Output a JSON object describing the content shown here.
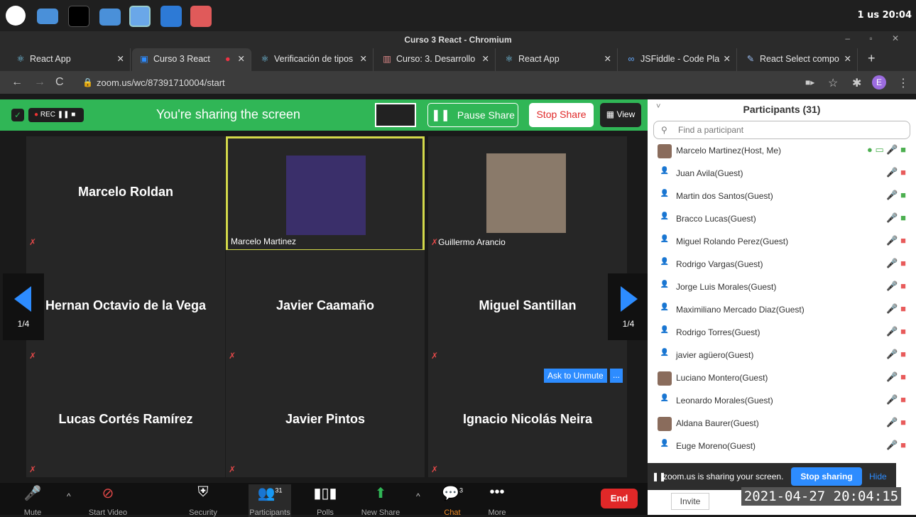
{
  "taskbar": {
    "tray_text": "1 us  20:04",
    "icons": [
      "mint-menu-icon",
      "files-icon",
      "terminal-icon",
      "folder-icon",
      "chromium-icon",
      "vscode-icon",
      "glasses-app-icon"
    ]
  },
  "window": {
    "title": "Curso 3 React - Chromium",
    "tabs": [
      {
        "label": "React App",
        "active": false
      },
      {
        "label": "Curso 3 React",
        "active": true
      },
      {
        "label": "Verificación de tipos",
        "active": false
      },
      {
        "label": "Curso: 3. Desarrollo",
        "active": false
      },
      {
        "label": "React App",
        "active": false
      },
      {
        "label": "JSFiddle - Code Pla",
        "active": false
      },
      {
        "label": "React Select compo",
        "active": false
      }
    ],
    "url": "zoom.us/wc/87391710004/start",
    "profile_initial": "E"
  },
  "share_bar": {
    "rec_label": "REC",
    "sharing_text": "You're sharing the screen",
    "pause_label": "Pause Share",
    "stop_label": "Stop Share",
    "view_label": "View"
  },
  "gallery": {
    "page": "1/4",
    "tiles": [
      {
        "name": "Marcelo Roldan",
        "mode": "name"
      },
      {
        "name": "Marcelo Martinez",
        "mode": "video"
      },
      {
        "name": "Guillermo Arancio",
        "mode": "video"
      },
      {
        "name": "Hernan Octavio de la Vega",
        "mode": "name"
      },
      {
        "name": "Javier Caamaño",
        "mode": "name"
      },
      {
        "name": "Miguel Santillan",
        "mode": "name"
      },
      {
        "name": "Lucas Cortés Ramírez",
        "mode": "name"
      },
      {
        "name": "Javier Pintos",
        "mode": "name"
      },
      {
        "name": "Ignacio Nicolás Neira",
        "mode": "name"
      }
    ],
    "ask_to_unmute": "Ask to Unmute",
    "more_label": "..."
  },
  "toolbar": {
    "mute": "Mute",
    "start_video": "Start Video",
    "security": "Security",
    "participants": "Participants",
    "participants_count": "31",
    "polls": "Polls",
    "new_share": "New Share",
    "chat": "Chat",
    "chat_count": "3",
    "more": "More",
    "end": "End"
  },
  "participants": {
    "title": "Participants (31)",
    "search_placeholder": "Find a participant",
    "items": [
      {
        "name": "Marcelo Martinez(Host, Me)",
        "avatar": "photo"
      },
      {
        "name": "Juan Avila(Guest)",
        "avatar": "default"
      },
      {
        "name": "Martin dos Santos(Guest)",
        "avatar": "default"
      },
      {
        "name": "Bracco Lucas(Guest)",
        "avatar": "default"
      },
      {
        "name": "Miguel Rolando Perez(Guest)",
        "avatar": "default"
      },
      {
        "name": "Rodrigo Vargas(Guest)",
        "avatar": "default"
      },
      {
        "name": "Jorge Luis Morales(Guest)",
        "avatar": "default"
      },
      {
        "name": "Maximiliano Mercado Diaz(Guest)",
        "avatar": "default"
      },
      {
        "name": "Rodrigo Torres(Guest)",
        "avatar": "default"
      },
      {
        "name": "javier agüero(Guest)",
        "avatar": "default"
      },
      {
        "name": "Luciano Montero(Guest)",
        "avatar": "photo"
      },
      {
        "name": "Leonardo Morales(Guest)",
        "avatar": "default"
      },
      {
        "name": "Aldana Baurer(Guest)",
        "avatar": "photo"
      },
      {
        "name": "Euge Moreno(Guest)",
        "avatar": "default"
      }
    ],
    "invite_label": "Invite"
  },
  "notice": {
    "text": "zoom.us is sharing your screen.",
    "stop_label": "Stop sharing",
    "hide_label": "Hide"
  },
  "timestamp": "2021-04-27  20:04:15",
  "colors": {
    "zoom_green": "#30b656",
    "zoom_blue": "#2d8cff",
    "end_red": "#e02828"
  }
}
